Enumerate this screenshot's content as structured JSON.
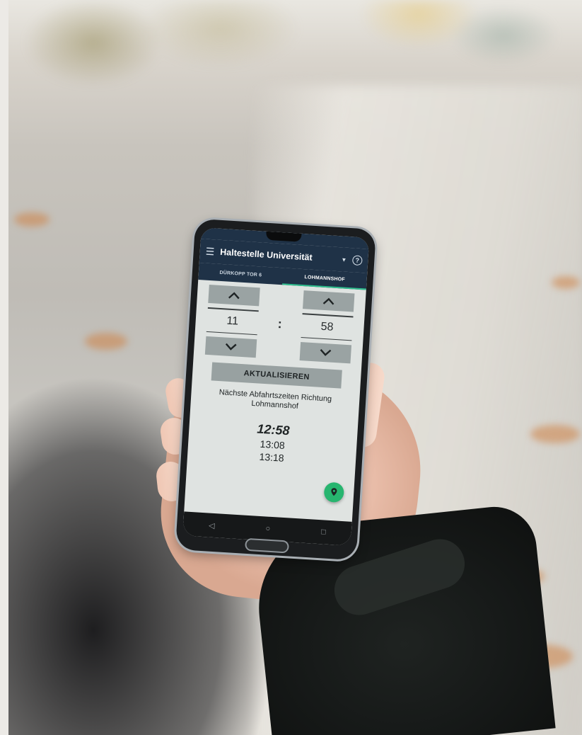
{
  "app": {
    "title": "Haltestelle Universität",
    "tabs": [
      {
        "label": "DÜRKOPP TOR 6",
        "active": false
      },
      {
        "label": "LOHMANNSHOF",
        "active": true
      }
    ],
    "time_picker": {
      "hour": "11",
      "separator": ":",
      "minute": "58"
    },
    "update_button": "AKTUALISIEREN",
    "next_departures_heading": "Nächste Abfahrtszeiten Richtung Lohmannshof",
    "departures": [
      "12:58",
      "13:08",
      "13:18"
    ]
  },
  "icons": {
    "menu": "menu-icon",
    "dropdown": "caret-down-icon",
    "help": "help-icon",
    "up": "chevron-up-icon",
    "down": "chevron-down-icon",
    "location": "location-pin-icon"
  },
  "colors": {
    "app_bar": "#1f3247",
    "tab_indicator": "#2fbf8e",
    "fab": "#27b56f",
    "button": "#98a1a1"
  }
}
